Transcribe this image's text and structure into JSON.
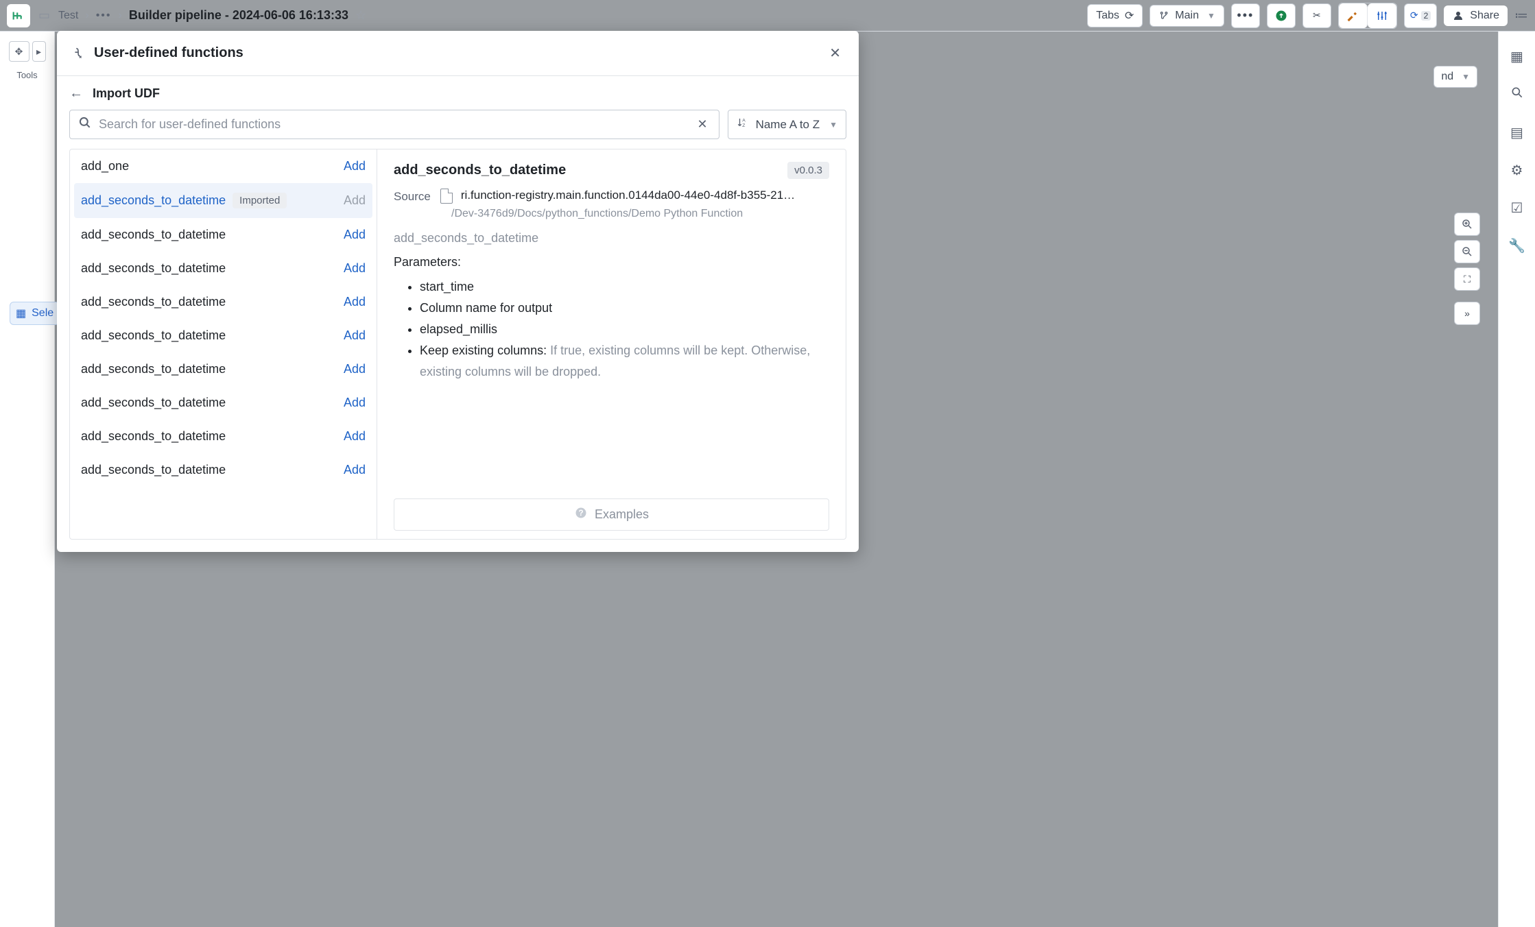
{
  "bg": {
    "breadcrumb_parent": "Test",
    "page_title": "Builder pipeline - 2024-06-06 16:13:33",
    "tabs_label": "Tabs",
    "branch_label": "Main",
    "share_label": "Share",
    "tools_label": "Tools",
    "select_label": "Sele",
    "expand_end_label": "nd",
    "refresh_count": "2"
  },
  "modal": {
    "title": "User-defined functions",
    "sub_title": "Import UDF",
    "search_placeholder": "Search for user-defined functions",
    "sort_label": "Name A to Z"
  },
  "list": [
    {
      "name": "add_one",
      "tag": null,
      "selected": false,
      "add": "Add",
      "muted": false
    },
    {
      "name": "add_seconds_to_datetime",
      "tag": "Imported",
      "selected": true,
      "add": "Add",
      "muted": true
    },
    {
      "name": "add_seconds_to_datetime",
      "tag": null,
      "selected": false,
      "add": "Add",
      "muted": false
    },
    {
      "name": "add_seconds_to_datetime",
      "tag": null,
      "selected": false,
      "add": "Add",
      "muted": false
    },
    {
      "name": "add_seconds_to_datetime",
      "tag": null,
      "selected": false,
      "add": "Add",
      "muted": false
    },
    {
      "name": "add_seconds_to_datetime",
      "tag": null,
      "selected": false,
      "add": "Add",
      "muted": false
    },
    {
      "name": "add_seconds_to_datetime",
      "tag": null,
      "selected": false,
      "add": "Add",
      "muted": false
    },
    {
      "name": "add_seconds_to_datetime",
      "tag": null,
      "selected": false,
      "add": "Add",
      "muted": false
    },
    {
      "name": "add_seconds_to_datetime",
      "tag": null,
      "selected": false,
      "add": "Add",
      "muted": false
    },
    {
      "name": "add_seconds_to_datetime",
      "tag": null,
      "selected": false,
      "add": "Add",
      "muted": false
    }
  ],
  "detail": {
    "title": "add_seconds_to_datetime",
    "version": "v0.0.3",
    "source_label": "Source",
    "source_rid": "ri.function-registry.main.function.0144da00-44e0-4d8f-b355-21…",
    "source_path": "/Dev-3476d9/Docs/python_functions/Demo Python Function",
    "sub_fn": "add_seconds_to_datetime",
    "params_heading": "Parameters:",
    "params": [
      {
        "label": "start_time",
        "desc": ""
      },
      {
        "label": "Column name for output",
        "desc": ""
      },
      {
        "label": "elapsed_millis",
        "desc": ""
      },
      {
        "label": "Keep existing columns:",
        "desc": "If true, existing columns will be kept. Otherwise, existing columns will be dropped."
      }
    ],
    "examples_label": "Examples"
  }
}
